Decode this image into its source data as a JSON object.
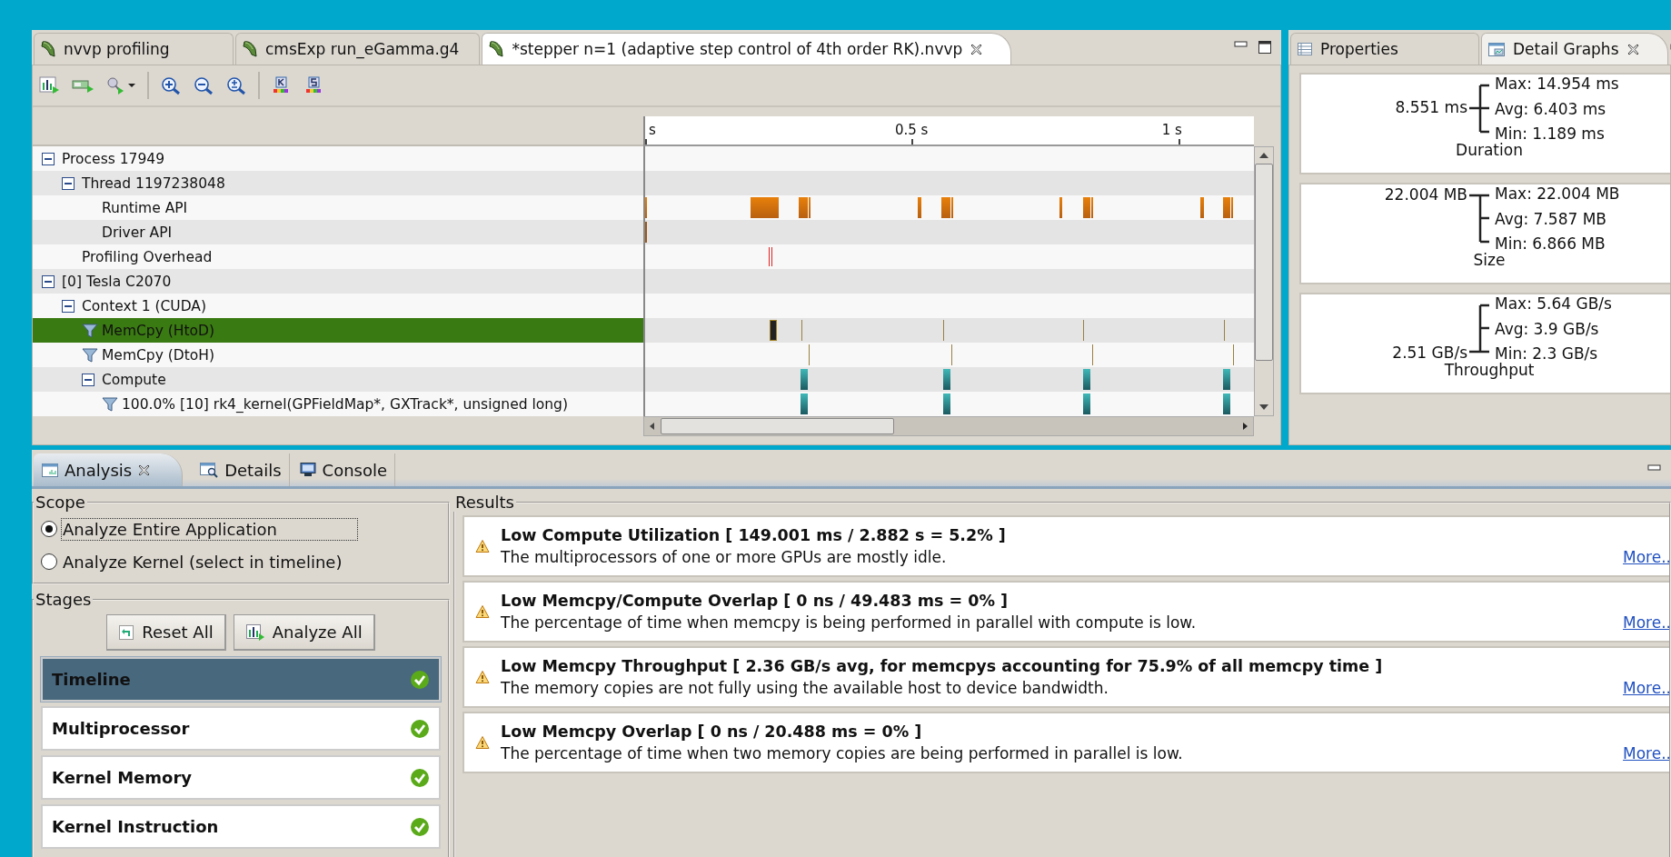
{
  "editor": {
    "tabs": [
      {
        "label": "nvvp profiling",
        "selected": false
      },
      {
        "label": "cmsExp run_eGamma.g4",
        "selected": false
      },
      {
        "label": "*stepper n=1 (adaptive step control of 4th order RK).nvvp",
        "selected": true
      }
    ],
    "ruler": {
      "ticks": [
        "s",
        "0.5 s",
        "1 s"
      ]
    },
    "tree": [
      {
        "label": "Process 17949",
        "kind": "group",
        "expanded": true,
        "selected": false,
        "children": [
          {
            "label": "Thread 1197238048",
            "kind": "group",
            "expanded": true,
            "selected": false,
            "children": [
              {
                "label": "Runtime API",
                "kind": "leaf",
                "selected": false
              },
              {
                "label": "Driver API",
                "kind": "leaf",
                "selected": false
              }
            ]
          },
          {
            "label": "Profiling Overhead",
            "kind": "leaf",
            "selected": false
          }
        ]
      },
      {
        "label": "[0] Tesla C2070",
        "kind": "group",
        "expanded": true,
        "selected": false,
        "children": [
          {
            "label": "Context 1 (CUDA)",
            "kind": "group",
            "expanded": true,
            "selected": false,
            "children": [
              {
                "label": "MemCpy (HtoD)",
                "kind": "filter",
                "selected": true
              },
              {
                "label": "MemCpy (DtoH)",
                "kind": "filter",
                "selected": false
              },
              {
                "label": "Compute",
                "kind": "group",
                "expanded": true,
                "selected": false,
                "children": [
                  {
                    "label": "100.0% [10] rk4_kernel(GPFieldMap*, GXTrack*, unsigned long)",
                    "kind": "filter",
                    "selected": false
                  }
                ]
              }
            ]
          }
        ]
      }
    ]
  },
  "side_panel": {
    "tabs": [
      {
        "label": "Properties",
        "selected": false
      },
      {
        "label": "Detail Graphs",
        "selected": true
      }
    ],
    "graphs": [
      {
        "title": "Duration",
        "value": "8.551 ms",
        "kind": "middle",
        "max": "Max: 14.954 ms",
        "avg": "Avg: 6.403 ms",
        "min": "Min: 1.189 ms"
      },
      {
        "title": "Size",
        "value": "22.004 MB",
        "kind": "top",
        "max": "Max: 22.004 MB",
        "avg": "Avg: 7.587 MB",
        "min": "Min: 6.866 MB"
      },
      {
        "title": "Throughput",
        "value": "2.51 GB/s",
        "kind": "bottom",
        "max": "Max: 5.64 GB/s",
        "avg": "Avg: 3.9 GB/s",
        "min": "Min: 2.3 GB/s"
      }
    ]
  },
  "bottom": {
    "tabs": [
      {
        "label": "Analysis",
        "selected": true
      },
      {
        "label": "Details",
        "selected": false
      },
      {
        "label": "Console",
        "selected": false
      }
    ],
    "scope": {
      "title": "Scope",
      "options": [
        {
          "label": "Analyze Entire Application",
          "selected": true
        },
        {
          "label": "Analyze Kernel (select in timeline)",
          "selected": false
        }
      ]
    },
    "stages": {
      "title": "Stages",
      "buttons": [
        "Reset All",
        "Analyze All"
      ],
      "items": [
        {
          "label": "Timeline",
          "selected": true,
          "done": true
        },
        {
          "label": "Multiprocessor",
          "selected": false,
          "done": true
        },
        {
          "label": "Kernel Memory",
          "selected": false,
          "done": true
        },
        {
          "label": "Kernel Instruction",
          "selected": false,
          "done": true
        }
      ]
    },
    "results": {
      "title": "Results",
      "items": [
        {
          "title": "Low Compute Utilization [ 149.001 ms / 2.882 s = 5.2% ]",
          "description": "The multiprocessors of one or more GPUs are mostly idle.",
          "link": "More.."
        },
        {
          "title": "Low Memcpy/Compute Overlap [ 0 ns / 49.483 ms = 0% ]",
          "description": "The percentage of time when memcpy is being performed in parallel with compute is low.",
          "link": "More.."
        },
        {
          "title": "Low Memcpy Throughput [ 2.36 GB/s avg, for memcpys accounting for 75.9% of all memcpy time ]",
          "description": "The memory copies are not fully using the available host to device bandwidth.",
          "link": "More.."
        },
        {
          "title": "Low Memcpy Overlap [ 0 ns / 20.488 ms = 0% ]",
          "description": "The percentage of time when two memory copies are being performed in parallel is low.",
          "link": "More.."
        }
      ]
    }
  }
}
